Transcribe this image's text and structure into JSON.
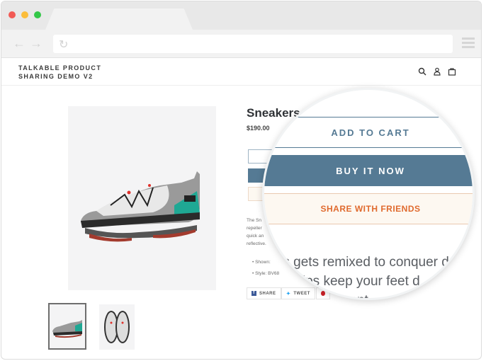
{
  "browser": {
    "back_icon": "arrow-left-icon",
    "forward_icon": "arrow-right-icon",
    "reload_icon": "reload-icon",
    "menu_icon": "hamburger-icon",
    "url": ""
  },
  "store": {
    "logo_line1": "TALKABLE PRODUCT",
    "logo_line2": "SHARING DEMO V2",
    "icons": [
      "search-icon",
      "account-icon",
      "cart-icon"
    ]
  },
  "product": {
    "title": "Sneakers",
    "price": "$190.00",
    "add_to_cart": "ADD TO CART",
    "buy_now": "BUY IT NOW",
    "share_with_friends": "SHARE WITH FRIENDS",
    "desc_lines": [
      "The Sn",
      "repeller",
      "quick an",
      "reflective."
    ],
    "bullets": [
      "Shown: ",
      "Style: BV68"
    ],
    "magnified_desc_lines": [
      "kers gets remixed to conquer d",
      "per helps keep your feet d",
      "o adjust. Element"
    ],
    "social": {
      "share": "SHARE",
      "tweet": "TWEET"
    }
  },
  "colors": {
    "accent": "#557a94",
    "share": "#e06a2e",
    "share_bg": "#fdf8f1"
  }
}
